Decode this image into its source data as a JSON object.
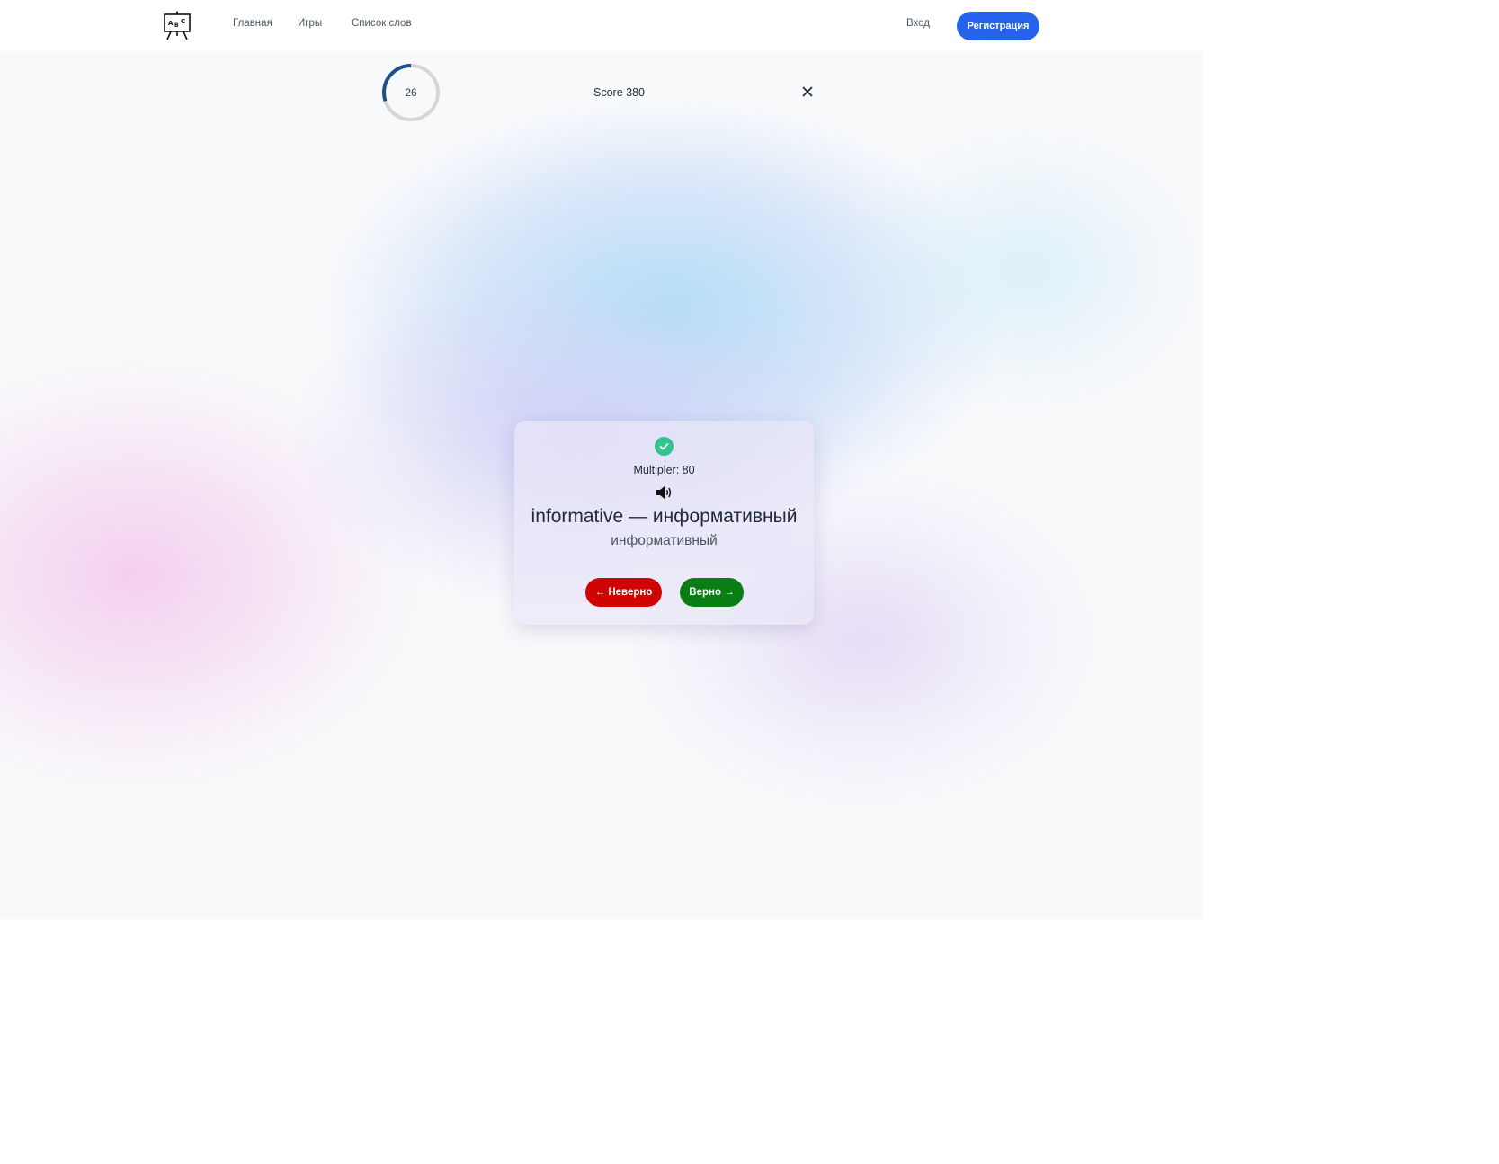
{
  "header": {
    "logo_icon": "easel-abc-icon",
    "nav": [
      {
        "label": "Главная"
      },
      {
        "label": "Игры"
      },
      {
        "label": "Список слов"
      }
    ],
    "login_label": "Вход",
    "register_label": "Регистрация",
    "accent_color": "#2563eb"
  },
  "game": {
    "timer_value": "26",
    "timer_progress": 0.3,
    "timer_color": "#1e4f8a",
    "score_text": "Score 380",
    "close_icon": "close-icon"
  },
  "card": {
    "status_icon": "check-circle-icon",
    "status_color": "#34c38f",
    "multiplier_text": "Multipler: 80",
    "speaker_icon": "speaker-icon",
    "word_line": "informative — информативный",
    "translation": "информативный",
    "wrong_label": "← Неверно",
    "wrong_color": "#d10404",
    "right_label": "Верно →",
    "right_color": "#0a7d14"
  }
}
